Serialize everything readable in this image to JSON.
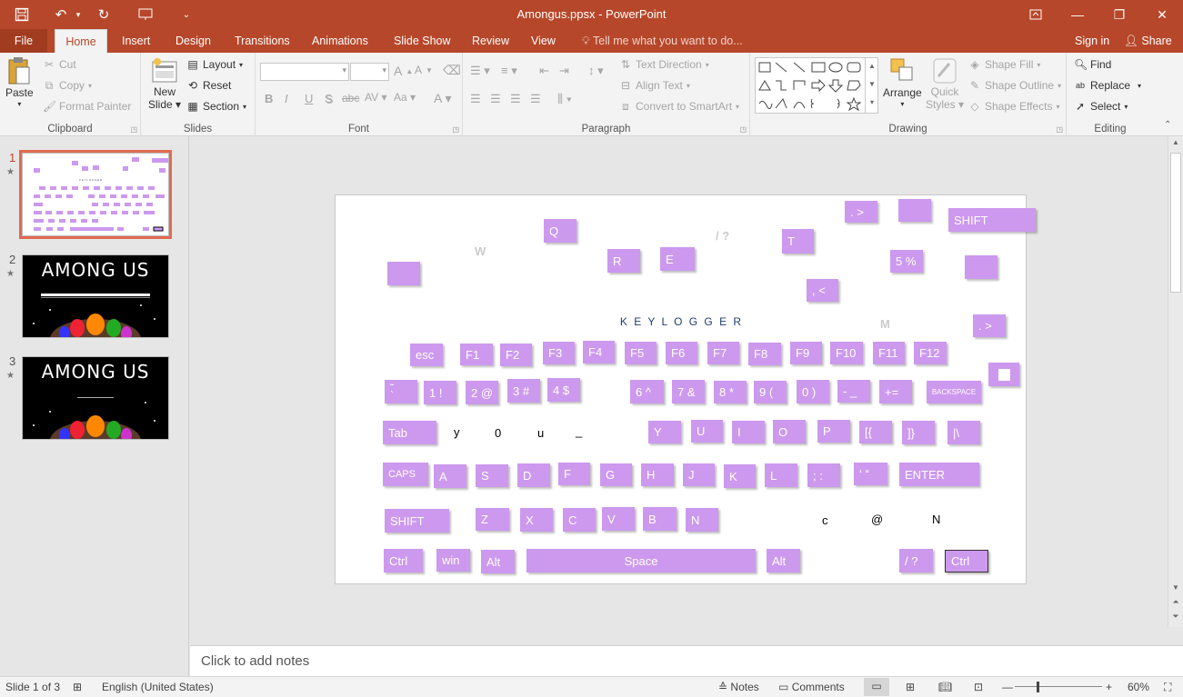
{
  "window": {
    "title": "Amongus.ppsx - PowerPoint",
    "minimize_icon": "—",
    "restore_icon": "❐",
    "close_icon": "✕"
  },
  "tabs": [
    {
      "label": "File"
    },
    {
      "label": "Home"
    },
    {
      "label": "Insert"
    },
    {
      "label": "Design"
    },
    {
      "label": "Transitions"
    },
    {
      "label": "Animations"
    },
    {
      "label": "Slide Show"
    },
    {
      "label": "Review"
    },
    {
      "label": "View"
    }
  ],
  "tell_me": "Tell me what you want to do...",
  "sign_in": "Sign in",
  "share": "Share",
  "ribbon": {
    "clipboard": {
      "label": "Clipboard",
      "paste": "Paste",
      "cut": "Cut",
      "copy": "Copy",
      "format_painter": "Format Painter"
    },
    "slides": {
      "label": "Slides",
      "new_slide_1": "New",
      "new_slide_2": "Slide",
      "layout": "Layout",
      "reset": "Reset",
      "section": "Section"
    },
    "font": {
      "label": "Font",
      "bold": "B",
      "italic": "I",
      "underline": "U",
      "strike": "S"
    },
    "paragraph": {
      "label": "Paragraph",
      "text_direction": "Text Direction",
      "align_text": "Align Text",
      "convert_smartart": "Convert to SmartArt"
    },
    "drawing": {
      "label": "Drawing",
      "arrange": "Arrange",
      "quick_styles_1": "Quick",
      "quick_styles_2": "Styles",
      "shape_fill": "Shape Fill",
      "shape_outline": "Shape Outline",
      "shape_effects": "Shape Effects"
    },
    "editing": {
      "label": "Editing",
      "find": "Find",
      "replace": "Replace",
      "select": "Select"
    }
  },
  "thumbnails": [
    {
      "number": "1",
      "star": "★"
    },
    {
      "number": "2",
      "star": "★",
      "heading": "AMONG US"
    },
    {
      "number": "3",
      "star": "★",
      "heading": "AMONG US"
    }
  ],
  "slide": {
    "title": "K E Y   L O G G E R",
    "keys": {
      "dot_gt_top": ". >",
      "shift_top": "SHIFT",
      "q": "Q",
      "r": "R",
      "e": "E",
      "t": "T",
      "five": "5 %",
      "comma_lt": ", <",
      "dot_gt_right": ". >",
      "esc": "esc",
      "f1": "F1",
      "f2": "F2",
      "f3": "F3",
      "f4": "F4",
      "f5": "F5",
      "f6": "F6",
      "f7": "F7",
      "f8": "F8",
      "f9": "F9",
      "f10": "F10",
      "f11": "F11",
      "f12": "F12",
      "tilde": "˜\n`",
      "k1": "1 !",
      "k2": "2 @",
      "k3": "3 #",
      "k4": "4 $",
      "k6": "6 ^",
      "k7": "7 &",
      "k8": "8 *",
      "k9": "9 (",
      "k0": "0 )",
      "minus": "- _",
      "plus": "+=",
      "backspace": "BACKSPACE",
      "tab": "Tab",
      "y": "Y",
      "u": "U",
      "i": "I",
      "o": "O",
      "p": "P",
      "lbrace": "[{",
      "rbrace": "]}",
      "pipe": "|\\",
      "caps": "CAPS",
      "a": "A",
      "s": "S",
      "d": "D",
      "f": "F",
      "g": "G",
      "h": "H",
      "j": "J",
      "k": "K",
      "l": "L",
      "semi": "; :",
      "quote": "‘ “",
      "enter": "ENTER",
      "shift_left": "SHIFT",
      "z": "Z",
      "x": "X",
      "c": "C",
      "v": "V",
      "b": "B",
      "n": "N",
      "ctrl_left": "Ctrl",
      "win": "win",
      "alt_left": "Alt",
      "space": "Space",
      "alt_right": "Alt",
      "slash": "/ ?",
      "ctrl_right": "Ctrl"
    },
    "loose_letters": {
      "w": "W",
      "slash_ghost": "/ ?",
      "m_ghost": "M",
      "y_small": "y",
      "zero": "0",
      "u_small": "u",
      "underscore": "_",
      "c_small": "c",
      "at": "@",
      "n_cap": "N"
    }
  },
  "notes_placeholder": "Click to add notes",
  "status": {
    "slide_of": "Slide 1 of 3",
    "language": "English (United States)",
    "notes": "Notes",
    "comments": "Comments",
    "zoom": "60%"
  }
}
